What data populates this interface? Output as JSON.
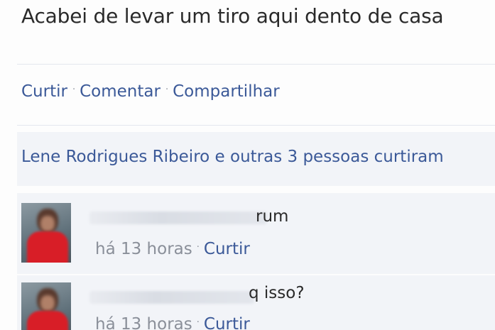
{
  "post": {
    "status_text": "Acabei de levar um tiro aqui dento de casa"
  },
  "actions": {
    "like_label": "Curtir",
    "comment_label": "Comentar",
    "share_label": "Compartilhar",
    "separator": "·"
  },
  "likes": {
    "summary": "Lene Rodrigues Ribeiro e outras 3 pessoas curtiram"
  },
  "comments": [
    {
      "text_visible": "rum",
      "time": "há 13 horas",
      "like_label": "Curtir",
      "separator": "·"
    },
    {
      "text_visible": "q isso?",
      "time": "há 13 horas",
      "like_label": "Curtir",
      "separator": "·"
    }
  ],
  "colors": {
    "link": "#3b5998",
    "text": "#2a2a2a",
    "meta": "#8a8f99",
    "panel": "#f2f4f8",
    "avatar_shirt": "#d81e27"
  }
}
